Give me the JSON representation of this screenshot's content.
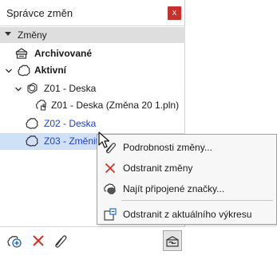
{
  "panel": {
    "title": "Správce změn",
    "close_label": "x",
    "section_label": "Změny"
  },
  "tree": {
    "archived": "Archivované",
    "active": "Aktivní",
    "z01": "Z01 - Deska",
    "z01_child": "Z01 - Deska (Změna 20 1.pln)",
    "z02": "Z02 - Deska",
    "z03": "Z03 - Změnit"
  },
  "menu": {
    "details": "Podrobnosti změny...",
    "remove": "Odstranit změny",
    "find_marks": "Najít připojené značky...",
    "remove_current": "Odstranit z aktuálního výkresu"
  },
  "colors": {
    "accent_blue": "#1f3fd4",
    "close_red": "#c8302b",
    "delete_red": "#d93025",
    "selection": "#cfe0f7"
  },
  "icons": {
    "archive": "archive-box-icon",
    "cloud": "revision-cloud-icon",
    "details": "paperclip-pencil-icon",
    "delete": "x-delete-icon",
    "find": "linked-markers-icon",
    "remove_current": "remove-from-view-icon",
    "new": "new-change-icon",
    "settings": "change-settings-icon"
  }
}
